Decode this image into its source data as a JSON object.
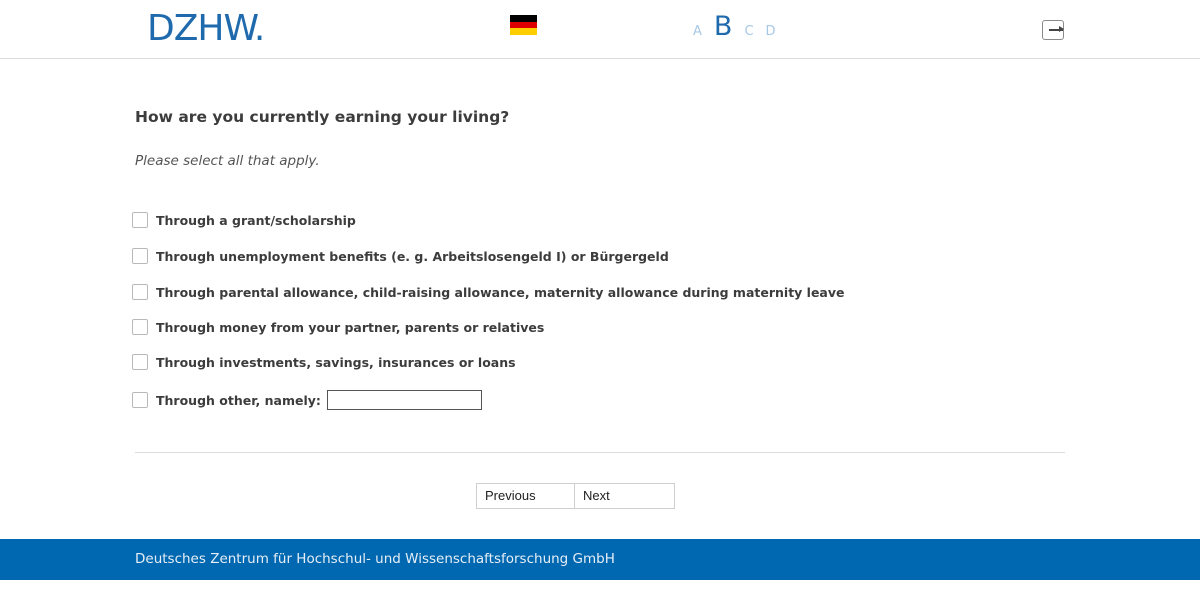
{
  "header": {
    "logo_text": "DZHW.",
    "flag": {
      "name": "german-flag-icon",
      "colors": [
        "#000000",
        "#dd0000",
        "#ffce00"
      ]
    },
    "letters": [
      {
        "label": "A",
        "active": false
      },
      {
        "label": "B",
        "active": true
      },
      {
        "label": "C",
        "active": false
      },
      {
        "label": "D",
        "active": false
      }
    ],
    "exit_icon": "exit-icon"
  },
  "main": {
    "question": "How are you currently earning your living?",
    "instruction": "Please select all that apply.",
    "options": [
      {
        "label": "Through a grant/scholarship",
        "checked": false
      },
      {
        "label": "Through unemployment benefits (e. g. Arbeitslosengeld I) or Bürgergeld",
        "checked": false
      },
      {
        "label": "Through parental allowance, child-raising allowance, maternity allowance during maternity leave",
        "checked": false
      },
      {
        "label": "Through money from your partner, parents or relatives",
        "checked": false
      },
      {
        "label": "Through investments, savings, insurances or loans",
        "checked": false
      },
      {
        "label": "Through other, namely:",
        "checked": false,
        "text_value": ""
      }
    ],
    "nav": {
      "previous_label": "Previous",
      "next_label": "Next"
    }
  },
  "footer": {
    "text": "Deutsches Zentrum für Hochschul- und Wissenschaftsforschung GmbH"
  },
  "colors": {
    "brand_blue": "#1f6aad",
    "footer_blue": "#0068b0",
    "inactive_letter": "#a6c8e6"
  }
}
